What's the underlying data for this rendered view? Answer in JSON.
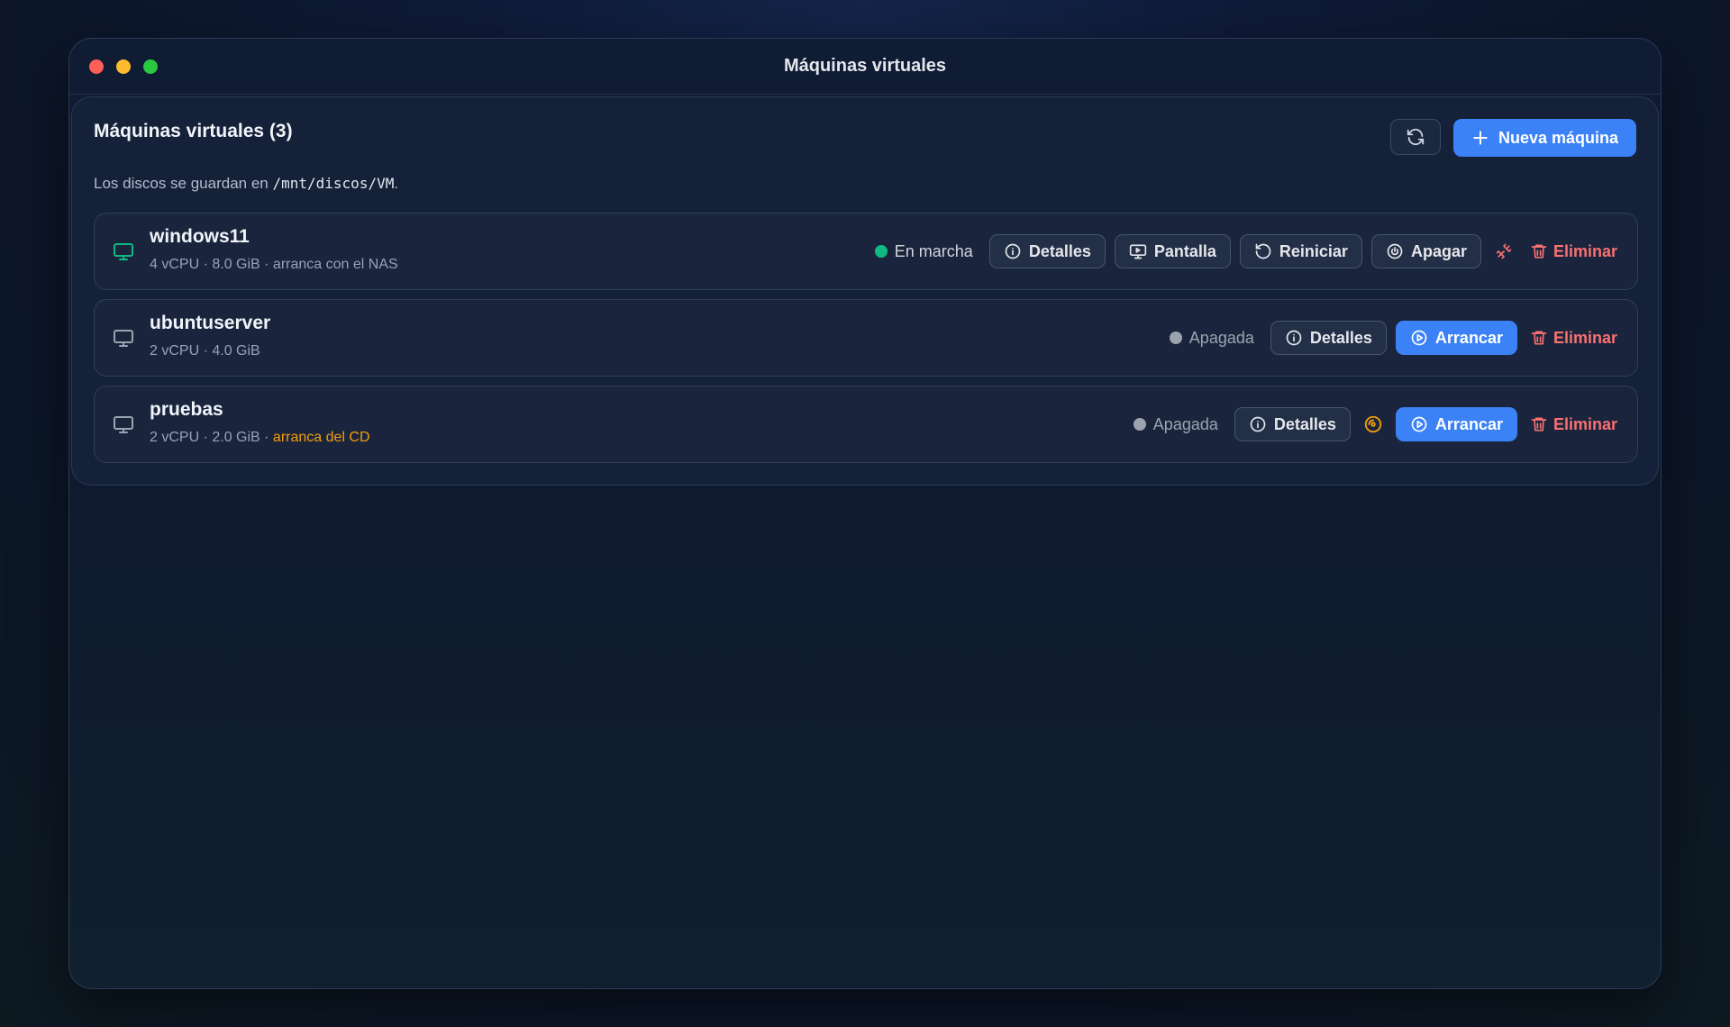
{
  "window": {
    "title": "Máquinas virtuales"
  },
  "header": {
    "title": "Máquinas virtuales (3)",
    "new_label": "Nueva máquina"
  },
  "note": {
    "prefix": "Los discos se guardan en",
    "path": "/mnt/discos/VM",
    "suffix": "."
  },
  "labels": {
    "details": "Detalles",
    "screen": "Pantalla",
    "restart": "Reiniciar",
    "shutdown": "Apagar",
    "start": "Arrancar",
    "delete": "Eliminar"
  },
  "vms": [
    {
      "name": "windows11",
      "meta": "4 vCPU · 8.0 GiB · arranca con el NAS",
      "meta_warn": "",
      "status": "En marcha",
      "running": true
    },
    {
      "name": "ubuntuserver",
      "meta": "2 vCPU · 4.0 GiB",
      "meta_warn": "",
      "status": "Apagada",
      "running": false
    },
    {
      "name": "pruebas",
      "meta": "2 vCPU · 2.0 GiB · ",
      "meta_warn": "arranca del CD",
      "status": "Apagada",
      "running": false
    }
  ],
  "colors": {
    "accent": "#3b82f6",
    "running": "#10b981",
    "danger": "#f87171",
    "warning": "#f59e0b"
  },
  "icons": {
    "monitor": "monitor-icon",
    "refresh": "refresh-icon",
    "plus": "plus-icon",
    "info": "info-icon",
    "screen": "screen-share-icon",
    "restart": "restart-icon",
    "power": "power-icon",
    "play": "play-circle-icon",
    "trash": "trash-icon",
    "unplug": "unplug-icon",
    "disc": "disc-icon"
  }
}
